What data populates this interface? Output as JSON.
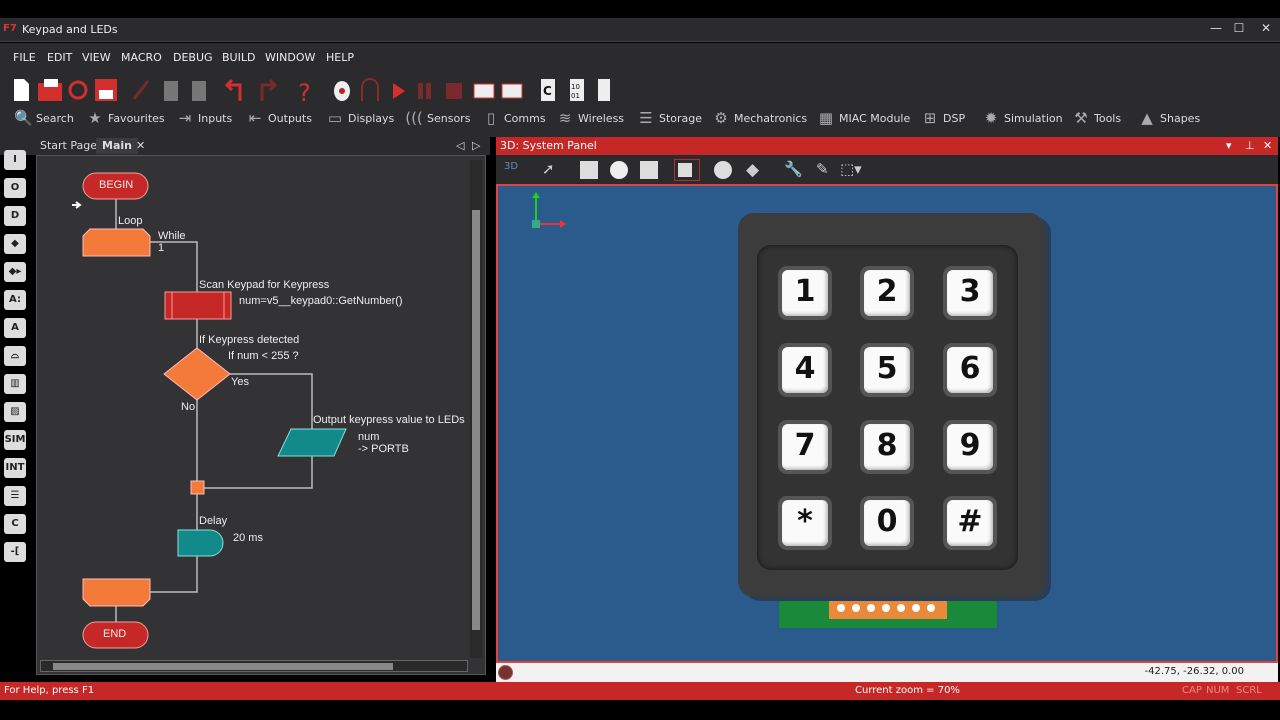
{
  "window": {
    "title": "Keypad and LEDs",
    "min": "—",
    "max": "☐",
    "close": "✕"
  },
  "menu": [
    "FILE",
    "EDIT",
    "VIEW",
    "MACRO",
    "DEBUG",
    "BUILD",
    "WINDOW",
    "HELP"
  ],
  "categories": [
    {
      "label": "Search",
      "icon": "🔍"
    },
    {
      "label": "Favourites",
      "icon": "★"
    },
    {
      "label": "Inputs",
      "icon": "⇥"
    },
    {
      "label": "Outputs",
      "icon": "⇤"
    },
    {
      "label": "Displays",
      "icon": "▭"
    },
    {
      "label": "Sensors",
      "icon": "((("
    },
    {
      "label": "Comms",
      "icon": "▯"
    },
    {
      "label": "Wireless",
      "icon": "≋"
    },
    {
      "label": "Storage",
      "icon": "☰"
    },
    {
      "label": "Mechatronics",
      "icon": "⚙"
    },
    {
      "label": "MIAC Module",
      "icon": "▦"
    },
    {
      "label": "DSP",
      "icon": "⊞"
    },
    {
      "label": "Simulation",
      "icon": "✹"
    },
    {
      "label": "Tools",
      "icon": "⚒"
    },
    {
      "label": "Shapes",
      "icon": "▲"
    }
  ],
  "tabs": {
    "start": "Start Page",
    "main": "Main",
    "close": "✕"
  },
  "symbols": [
    "I",
    "O",
    "D",
    "◆",
    "◆▸",
    "A:",
    "A",
    "⌓",
    "▥",
    "▨",
    "SIM",
    "INT",
    "☰",
    "C",
    "-["
  ],
  "flowchart": {
    "begin": "BEGIN",
    "end": "END",
    "loop_label": "Loop",
    "while": "While",
    "while_cond": "1",
    "call_label": "Scan Keypad for Keypress",
    "call_expr": "num=v5__keypad0::GetNumber()",
    "decision_label": "If Keypress detected",
    "decision_expr": "If  num < 255 ?",
    "yes": "Yes",
    "no": "No",
    "output_label": "Output keypress value to LEDs",
    "output_var": "num",
    "output_port": "-> PORTB",
    "delay_label": "Delay",
    "delay_value": "20 ms"
  },
  "system_panel": {
    "title": "3D: System Panel",
    "mode": "3D",
    "coords": "-42.75, -26.32, 0.00",
    "keypad_keys": [
      "1",
      "2",
      "3",
      "4",
      "5",
      "6",
      "7",
      "8",
      "9",
      "*",
      "0",
      "#"
    ]
  },
  "statusbar": {
    "help": "For Help, press F1",
    "zoom": "Current zoom = 70%",
    "cap": "CAP",
    "num": "NUM",
    "scrl": "SCRL"
  }
}
